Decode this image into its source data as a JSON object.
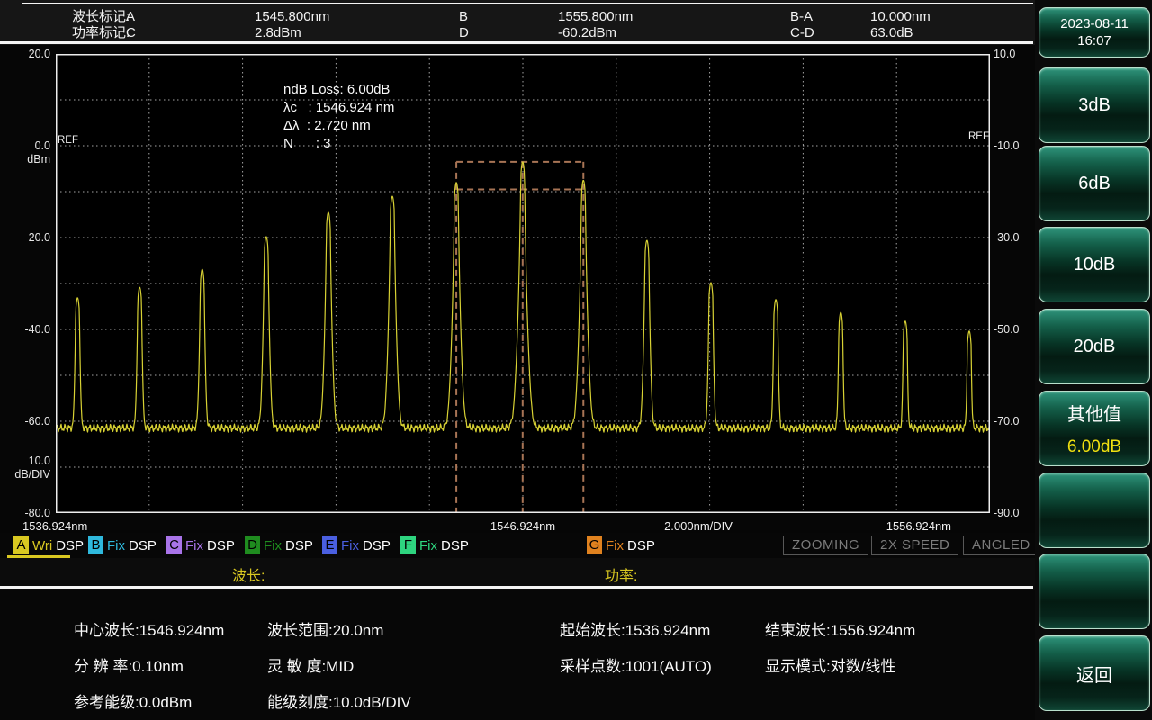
{
  "marker_bar": {
    "rows": [
      {
        "label": "波长标记:",
        "m1": "A",
        "v1": "1545.800nm",
        "m2": "B",
        "v2": "1555.800nm",
        "diff": "B-A",
        "diff_v": "10.000nm"
      },
      {
        "label": "功率标记:",
        "m1": "C",
        "v1": "2.8dBm",
        "m2": "D",
        "v2": "-60.2dBm",
        "diff": "C-D",
        "diff_v": "63.0dB"
      }
    ]
  },
  "datetime": {
    "date": "2023-08-11",
    "time": "16:07"
  },
  "chart_data": {
    "type": "line",
    "title": "optical spectrum trace",
    "x_min": 1536.924,
    "x_max": 1556.924,
    "x_div_nm": 2.0,
    "y_left_max": 20.0,
    "y_left_min": -80.0,
    "y_div_db": 10.0,
    "y_right_max": 10.0,
    "y_right_min": -90.0,
    "grid": true,
    "noise_floor_dbm": -61.5,
    "trace_color": "#d8d234",
    "grid_color": "#cfcfcf",
    "peaks": [
      {
        "nm": 1537.39,
        "dbm": -33.1
      },
      {
        "nm": 1538.72,
        "dbm": -30.8
      },
      {
        "nm": 1540.06,
        "dbm": -26.9
      },
      {
        "nm": 1541.43,
        "dbm": -19.8
      },
      {
        "nm": 1542.76,
        "dbm": -14.5
      },
      {
        "nm": 1544.13,
        "dbm": -11.0
      },
      {
        "nm": 1545.5,
        "dbm": -8.0
      },
      {
        "nm": 1546.92,
        "dbm": -3.5
      },
      {
        "nm": 1548.22,
        "dbm": -7.5
      },
      {
        "nm": 1549.58,
        "dbm": -20.6
      },
      {
        "nm": 1550.95,
        "dbm": -29.8
      },
      {
        "nm": 1552.34,
        "dbm": -33.5
      },
      {
        "nm": 1553.73,
        "dbm": -36.3
      },
      {
        "nm": 1555.11,
        "dbm": -38.2
      },
      {
        "nm": 1556.48,
        "dbm": -40.4
      }
    ],
    "ndb_marker": {
      "left_nm": 1545.5,
      "center_nm": 1546.92,
      "right_nm": 1548.22,
      "top_dbm": -3.5,
      "ndb_dbm": -9.5,
      "color": "#a87455"
    },
    "annotation_lines": [
      "ndB Loss: 6.00dB",
      "λc   : 1546.924 nm",
      "Δλ  : 2.720 nm",
      "N      : 3"
    ],
    "ref_label": "REF",
    "left_ticks": [
      "20.0",
      "0.0",
      "-20.0",
      "-40.0",
      "-60.0",
      "-80.0"
    ],
    "left_unit": "dBm",
    "left_scale_lines": [
      "10.0",
      "dB/DIV"
    ],
    "right_ticks": [
      "10.0",
      "-10.0",
      "-30.0",
      "-50.0",
      "-70.0",
      "-90.0"
    ],
    "x_ticks": [
      "1536.924nm",
      "1546.924nm",
      "2.000nm/DIV",
      "1556.924nm"
    ]
  },
  "legend": {
    "dsp": "DSP",
    "traces": [
      {
        "letter": "A",
        "mode": "Wri",
        "color": "#d9c821",
        "selected": true
      },
      {
        "letter": "B",
        "mode": "Fix",
        "color": "#2fb9dd",
        "selected": false
      },
      {
        "letter": "C",
        "mode": "Fix",
        "color": "#a974e9",
        "selected": false
      },
      {
        "letter": "D",
        "mode": "Fix",
        "color": "#1f8c1f",
        "selected": false
      },
      {
        "letter": "E",
        "mode": "Fix",
        "color": "#4a5fe0",
        "selected": false
      },
      {
        "letter": "F",
        "mode": "Fix",
        "color": "#2ed47f",
        "selected": false
      },
      {
        "letter": "G",
        "mode": "Fix",
        "color": "#e0821f",
        "selected": false
      }
    ],
    "status_buttons": [
      "ZOOMING",
      "2X SPEED",
      "ANGLED"
    ]
  },
  "section_headers": {
    "wavelength": "波长:",
    "power": "功率:"
  },
  "params": {
    "rows": [
      [
        "中心波长:1546.924nm",
        "波长范围:20.0nm",
        "起始波长:1536.924nm",
        "结束波长:1556.924nm"
      ],
      [
        "分 辨 率:0.10nm",
        "灵 敏 度:MID",
        "采样点数:1001(AUTO)",
        "显示模式:对数/线性"
      ],
      [
        "参考能级:0.0dBm",
        "能级刻度:10.0dB/DIV",
        "",
        ""
      ]
    ]
  },
  "sidebar": {
    "buttons": [
      {
        "label": "3dB",
        "sub": ""
      },
      {
        "label": "6dB",
        "sub": ""
      },
      {
        "label": "10dB",
        "sub": ""
      },
      {
        "label": "20dB",
        "sub": ""
      },
      {
        "label": "其他值",
        "sub": "6.00dB"
      },
      {
        "label": "",
        "sub": ""
      },
      {
        "label": "",
        "sub": ""
      },
      {
        "label": "返回",
        "sub": ""
      }
    ]
  }
}
